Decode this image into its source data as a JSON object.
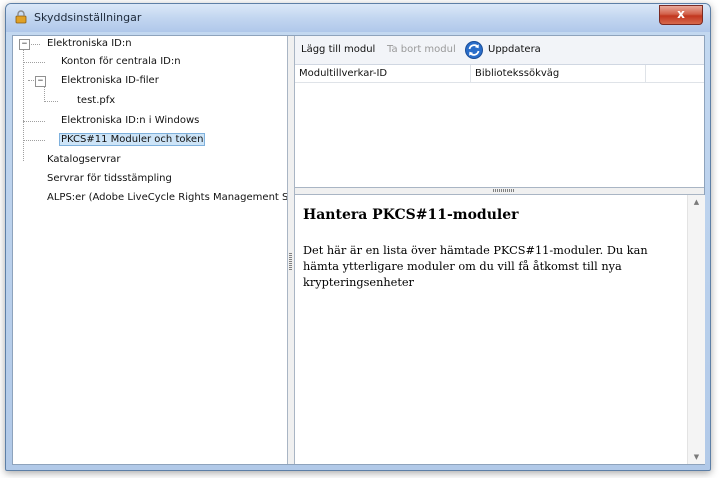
{
  "window": {
    "title": "Skyddsinställningar",
    "close_glyph": "x"
  },
  "tree": {
    "items": [
      {
        "label": "Elektroniska ID:n",
        "expander": "−"
      },
      {
        "label": "Konton för centrala ID:n"
      },
      {
        "label": "Elektroniska ID-filer",
        "expander": "−"
      },
      {
        "label": "test.pfx"
      },
      {
        "label": "Elektroniska ID:n i Windows"
      },
      {
        "label": "PKCS#11 Moduler och token",
        "selected": true
      },
      {
        "label": "Katalogservrar"
      },
      {
        "label": "Servrar för tidsstämpling"
      },
      {
        "label": "ALPS:er (Adobe LiveCycle Rights Management Ser"
      }
    ]
  },
  "toolbar": {
    "add_module": "Lägg till modul",
    "remove_module": "Ta bort modul",
    "refresh": "Uppdatera"
  },
  "table": {
    "columns": [
      "Modultillverkar-ID",
      "Bibliotekssökväg"
    ]
  },
  "info": {
    "title": "Hantera PKCS#11-moduler",
    "text": "Det här är en lista över hämtade PKCS#11-moduler. Du kan hämta ytterligare moduler om du vill få åtkomst till nya krypteringsenheter"
  },
  "scroll": {
    "up_glyph": "▲",
    "down_glyph": "▼"
  },
  "colors": {
    "selection_bg": "#cde4f7",
    "close_red": "#c2361f",
    "refresh_blue": "#2a6dc9"
  }
}
